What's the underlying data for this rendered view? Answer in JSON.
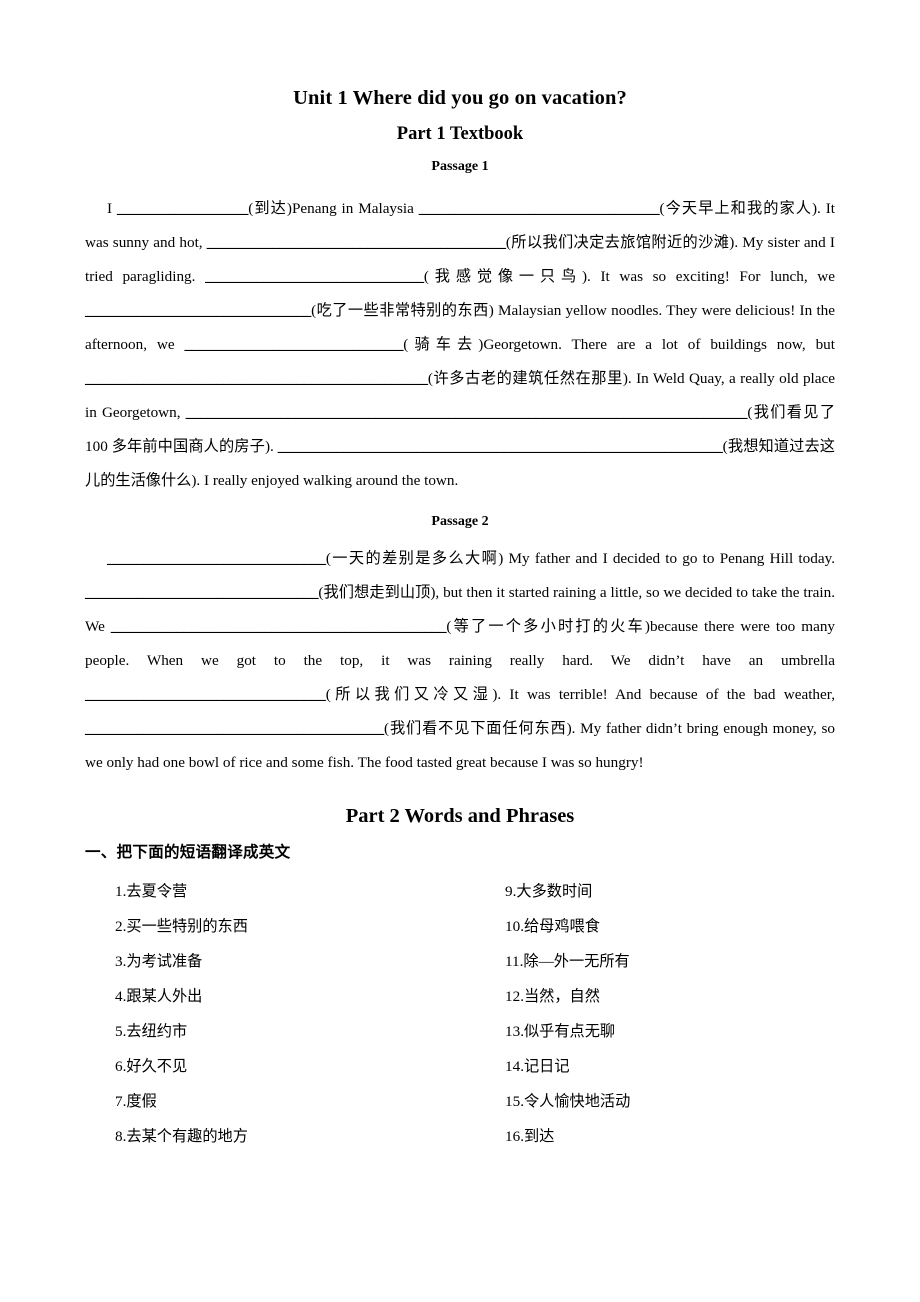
{
  "document": {
    "title": "Unit 1 Where did you go on vacation?",
    "part1_title": "Part 1 Textbook",
    "part2_title": "Part 2 Words and Phrases",
    "passage1_label": "Passage 1",
    "passage2_label": "Passage 2"
  },
  "passage1": {
    "segments": [
      {
        "type": "text",
        "value": "I "
      },
      {
        "type": "blank",
        "value": "__________________"
      },
      {
        "type": "text",
        "value": "(到达)Penang in Malaysia "
      },
      {
        "type": "blank",
        "value": "_________________________________"
      },
      {
        "type": "text",
        "value": "(今天早上和我的家人). It was sunny and hot, "
      },
      {
        "type": "blank",
        "value": "_________________________________________"
      },
      {
        "type": "text",
        "value": "(所以我们决定去旅馆附近的沙滩). My sister and I tried paragliding. "
      },
      {
        "type": "blank",
        "value": "______________________________"
      },
      {
        "type": "text",
        "value": "(我感觉像一只鸟). It was so exciting! For lunch, we "
      },
      {
        "type": "blank",
        "value": "_______________________________"
      },
      {
        "type": "text",
        "value": "(吃了一些非常特别的东西) Malaysian yellow noodles. They were delicious! In the afternoon, we "
      },
      {
        "type": "blank",
        "value": "______________________________"
      },
      {
        "type": "text",
        "value": "(骑车去)Georgetown. There are a lot of buildings now, but "
      },
      {
        "type": "blank",
        "value": "_______________________________________________"
      },
      {
        "type": "text",
        "value": "(许多古老的建筑任然在那里). In Weld Quay, a really old place in Georgetown, "
      },
      {
        "type": "blank",
        "value": "_____________________________________________________________________________"
      },
      {
        "type": "text",
        "value": "(我们看见了 100 多年前中国商人的房子). "
      },
      {
        "type": "blank",
        "value": "_____________________________________________________________"
      },
      {
        "type": "text",
        "value": "(我想知道过去这儿的生活像什么). I really enjoyed walking around the town."
      }
    ]
  },
  "passage2": {
    "segments": [
      {
        "type": "blank",
        "value": "______________________________"
      },
      {
        "type": "text",
        "value": "(一天的差别是多么大啊) My father and I decided to go to Penang Hill today. "
      },
      {
        "type": "blank",
        "value": "________________________________"
      },
      {
        "type": "text",
        "value": "(我们想走到山顶), but then it started raining a little, so we decided to take the train. We "
      },
      {
        "type": "blank",
        "value": "______________________________________________"
      },
      {
        "type": "text",
        "value": "(等了一个多小时打的火车)because there were too many people. When we got to the top, it was raining really hard. We didn’t have an umbrella "
      },
      {
        "type": "blank",
        "value": "_________________________________"
      },
      {
        "type": "text",
        "value": "(所以我们又冷又湿). It was terrible! And because of the bad weather, "
      },
      {
        "type": "blank",
        "value": "_________________________________________"
      },
      {
        "type": "text",
        "value": "(我们看不见下面任何东西). My father didn’t bring enough money, so we only had one bowl of rice and some fish. The food tasted great because I was so hungry!"
      }
    ]
  },
  "vocabulary": {
    "heading": "一、把下面的短语翻译成英文",
    "left_column": [
      {
        "num": "1.",
        "text": "去夏令营"
      },
      {
        "num": "2.",
        "text": "买一些特别的东西"
      },
      {
        "num": "3.",
        "text": "为考试准备"
      },
      {
        "num": "4.",
        "text": "跟某人外出"
      },
      {
        "num": "5.",
        "text": "去纽约市"
      },
      {
        "num": "6.",
        "text": "好久不见"
      },
      {
        "num": "7.",
        "text": "度假"
      },
      {
        "num": "8.",
        "text": "去某个有趣的地方"
      }
    ],
    "right_column": [
      {
        "num": "9.",
        "text": "大多数时间"
      },
      {
        "num": "10.",
        "text": "给母鸡喂食"
      },
      {
        "num": "11.",
        "text": "除—外一无所有"
      },
      {
        "num": "12.",
        "text": "当然，自然"
      },
      {
        "num": "13.",
        "text": "似乎有点无聊"
      },
      {
        "num": "14.",
        "text": "记日记"
      },
      {
        "num": "15.",
        "text": "令人愉快地活动"
      },
      {
        "num": "16.",
        "text": "到达"
      }
    ]
  }
}
